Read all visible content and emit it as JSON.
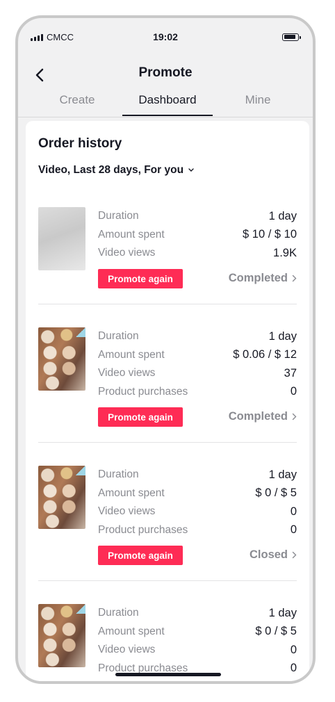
{
  "status_bar": {
    "carrier": "CMCC",
    "time": "19:02"
  },
  "header": {
    "title": "Promote"
  },
  "tabs": [
    {
      "label": "Create",
      "active": false
    },
    {
      "label": "Dashboard",
      "active": true
    },
    {
      "label": "Mine",
      "active": false
    }
  ],
  "order_history": {
    "title": "Order history",
    "filter_label": "Video, Last 28 days, For you",
    "promote_label": "Promote again",
    "orders": [
      {
        "thumbnail": "blank-video-thumbnail",
        "rows": [
          {
            "label": "Duration",
            "value": "1 day"
          },
          {
            "label": "Amount spent",
            "value": "$ 10 / $ 10"
          },
          {
            "label": "Video views",
            "value": "1.9K"
          }
        ],
        "status": "Completed"
      },
      {
        "thumbnail": "photo-video-thumbnail",
        "rows": [
          {
            "label": "Duration",
            "value": "1 day"
          },
          {
            "label": "Amount spent",
            "value": "$ 0.06 / $ 12"
          },
          {
            "label": "Video views",
            "value": "37"
          },
          {
            "label": "Product purchases",
            "value": "0"
          }
        ],
        "status": "Completed"
      },
      {
        "thumbnail": "photo-video-thumbnail",
        "rows": [
          {
            "label": "Duration",
            "value": "1 day"
          },
          {
            "label": "Amount spent",
            "value": "$ 0 / $ 5"
          },
          {
            "label": "Video views",
            "value": "0"
          },
          {
            "label": "Product purchases",
            "value": "0"
          }
        ],
        "status": "Closed"
      },
      {
        "thumbnail": "photo-video-thumbnail",
        "rows": [
          {
            "label": "Duration",
            "value": "1 day"
          },
          {
            "label": "Amount spent",
            "value": "$ 0 / $ 5"
          },
          {
            "label": "Video views",
            "value": "0"
          },
          {
            "label": "Product purchases",
            "value": "0"
          }
        ],
        "status": null
      }
    ]
  },
  "colors": {
    "accent": "#fe2c55",
    "text": "#161823",
    "muted": "#8a8b91",
    "background": "#f1f1f2"
  },
  "icons": [
    "signal-icon",
    "battery-icon",
    "back-arrow-icon",
    "chevron-down-icon",
    "chevron-right-icon"
  ]
}
